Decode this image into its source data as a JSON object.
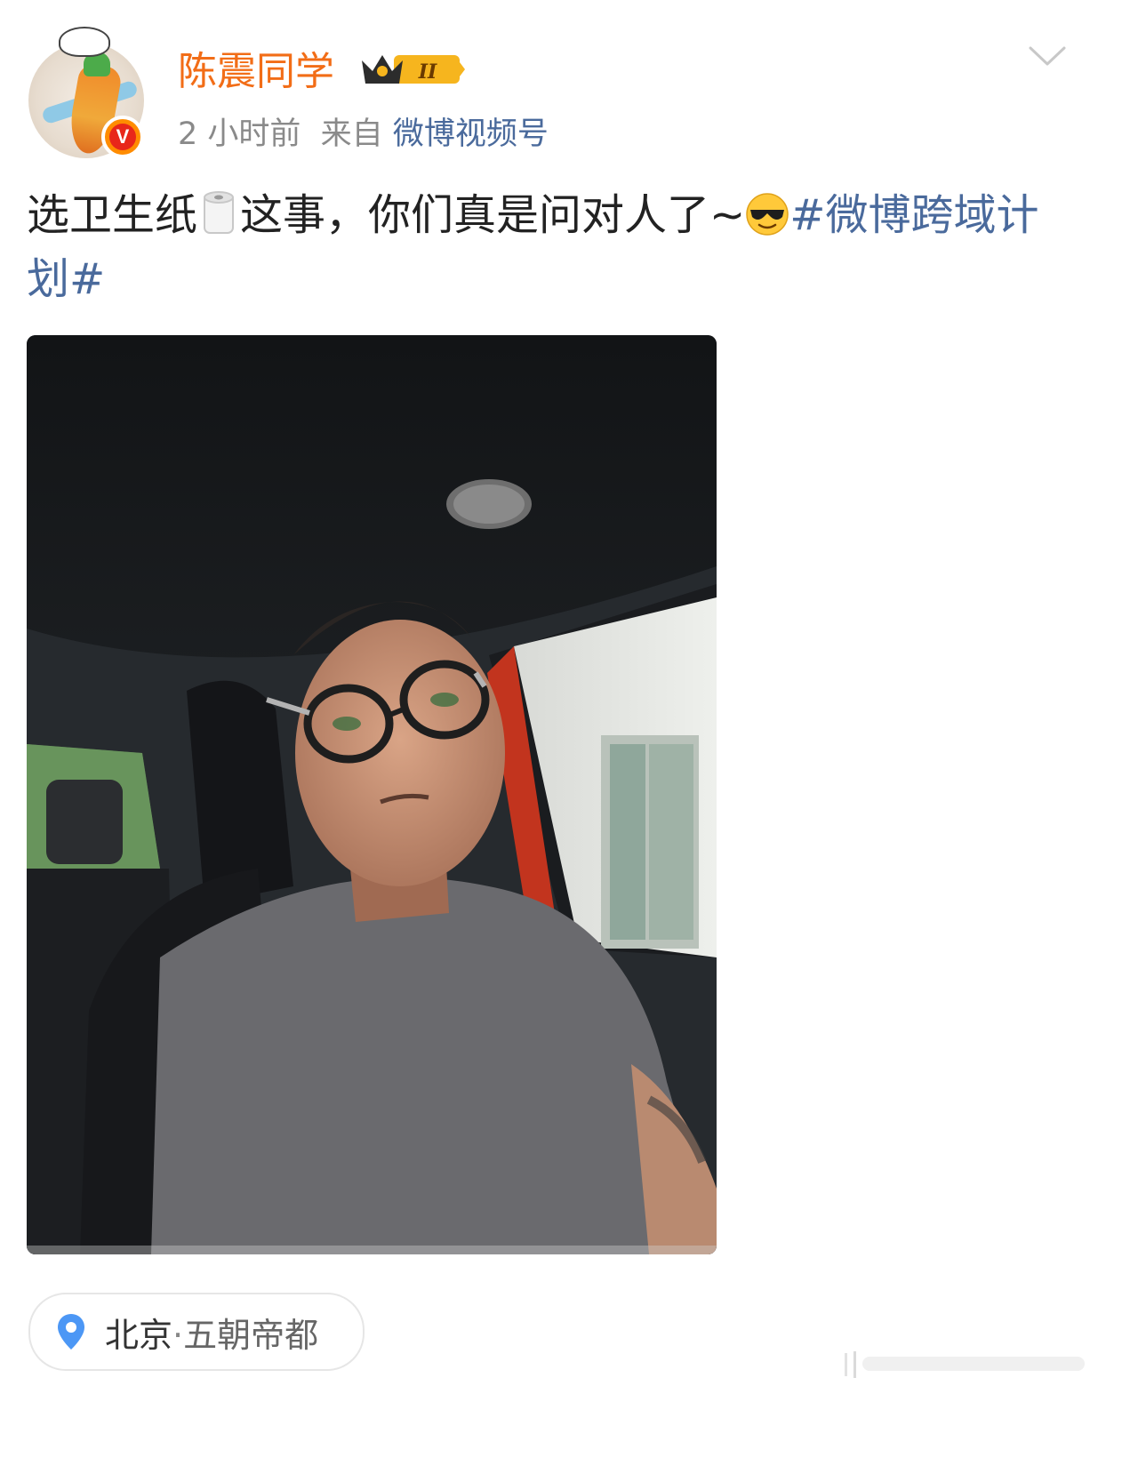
{
  "post": {
    "author": {
      "name": "陈震同学",
      "verified_badge": "V",
      "member_level": "II",
      "avatar_icon": "carrot-bunny-avatar"
    },
    "time": "2 小时前",
    "source_prefix": "来自",
    "source": "微博视频号",
    "text": {
      "part1": "选卫生纸",
      "emoji1": "toilet-paper-emoji",
      "part2": "这事，你们真是问对人了~",
      "emoji2": "sunglasses-emoji",
      "hashtag": "#微博跨域计划#"
    },
    "video": {
      "description_icon": "video-thumbnail"
    },
    "location": {
      "city": "北京",
      "separator": "·",
      "place": "五朝帝都",
      "icon": "location-pin-icon"
    }
  },
  "colors": {
    "username": "#f26d17",
    "link": "#4a6a9c",
    "meta": "#8a8a8a",
    "text": "#222222"
  }
}
